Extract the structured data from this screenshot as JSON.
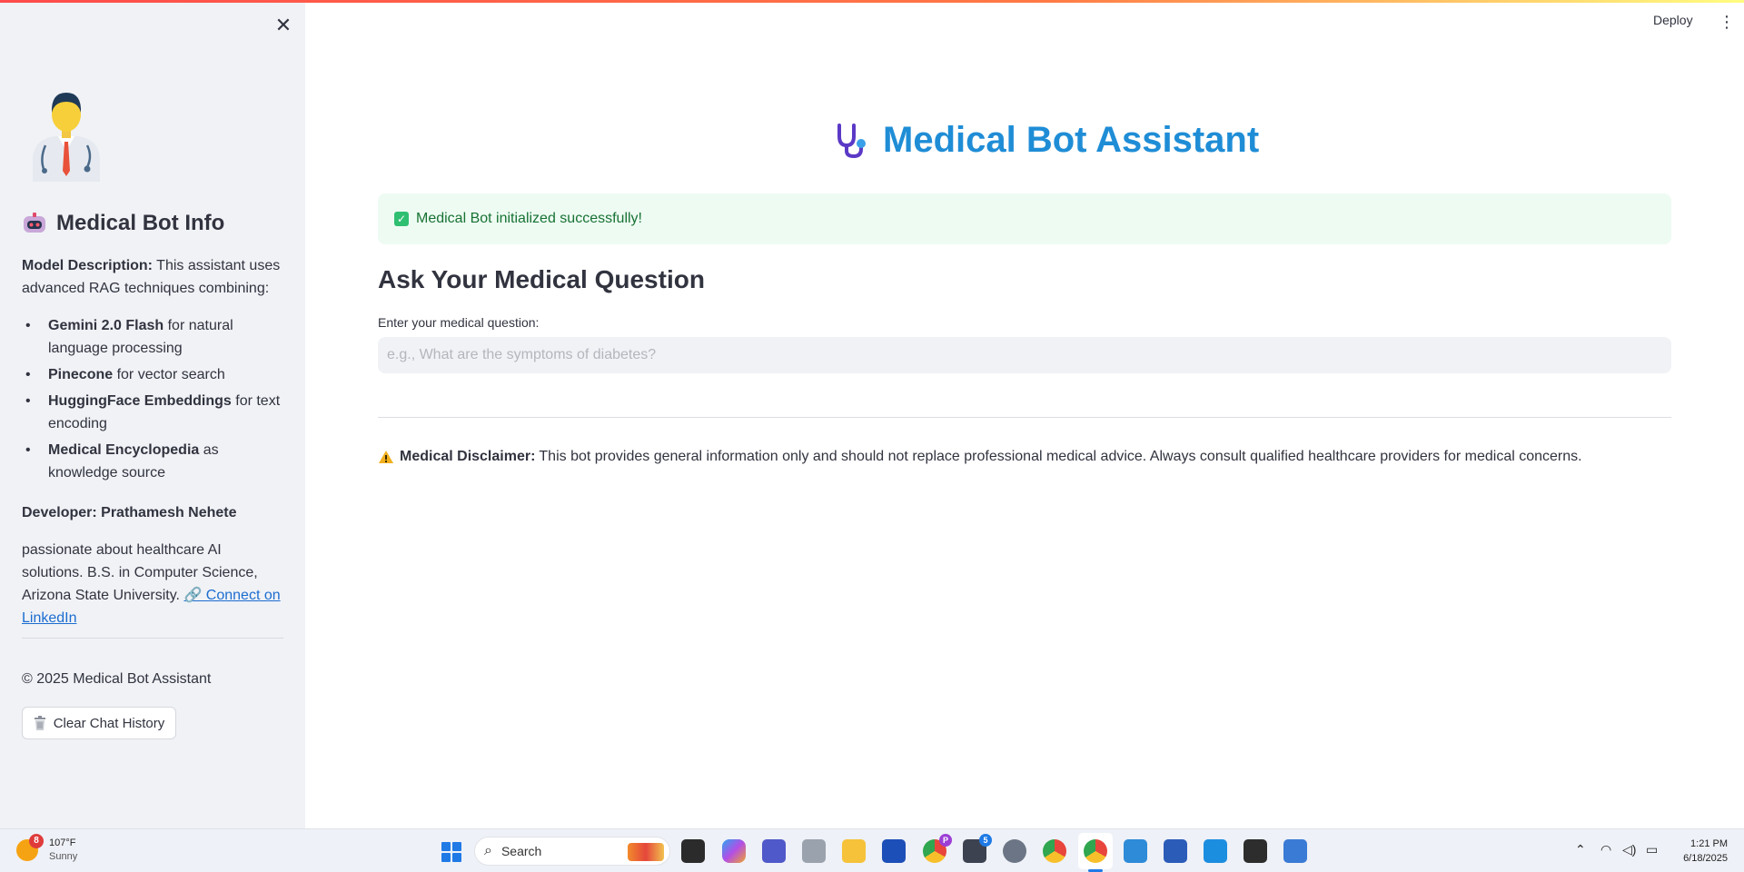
{
  "sidebar": {
    "heading": "Medical Bot Info",
    "model_description_label": "Model Description:",
    "model_description_text": " This assistant uses advanced RAG techniques combining:",
    "features": [
      {
        "name": "Gemini 2.0 Flash",
        "desc": " for natural language processing"
      },
      {
        "name": "Pinecone",
        "desc": " for vector search"
      },
      {
        "name": "HuggingFace Embeddings",
        "desc": " for text encoding"
      },
      {
        "name": "Medical Encyclopedia",
        "desc": " as knowledge source"
      }
    ],
    "developer_label": "Developer: Prathamesh Nehete",
    "bio": "passionate about healthcare AI solutions. B.S. in Computer Science, Arizona State University. ",
    "linkedin_label": "🔗 Connect on LinkedIn",
    "copyright": "© 2025 Medical Bot Assistant",
    "clear_button_label": "Clear Chat History"
  },
  "header": {
    "deploy_label": "Deploy"
  },
  "main": {
    "title": "Medical Bot Assistant",
    "success_message": "Medical Bot initialized successfully!",
    "section_heading": "Ask Your Medical Question",
    "input_label": "Enter your medical question:",
    "input_placeholder": "e.g., What are the symptoms of diabetes?",
    "input_value": "",
    "disclaimer_label": "Medical Disclaimer:",
    "disclaimer_text": "This bot provides general information only and should not replace professional medical advice. Always consult qualified healthcare providers for medical concerns."
  },
  "taskbar": {
    "weather_temp": "107°F",
    "weather_condition": "Sunny",
    "weather_badge": "8",
    "search_label": "Search",
    "chrome_profile_badge": "P",
    "app_badge_count": "5",
    "time": "1:21 PM",
    "date": "6/18/2025"
  },
  "colors": {
    "title": "#1f8dd6",
    "success_bg": "#eefbf3",
    "success_text": "#177233",
    "sidebar_bg": "#f0f2f6",
    "link": "#1c6dd0"
  }
}
